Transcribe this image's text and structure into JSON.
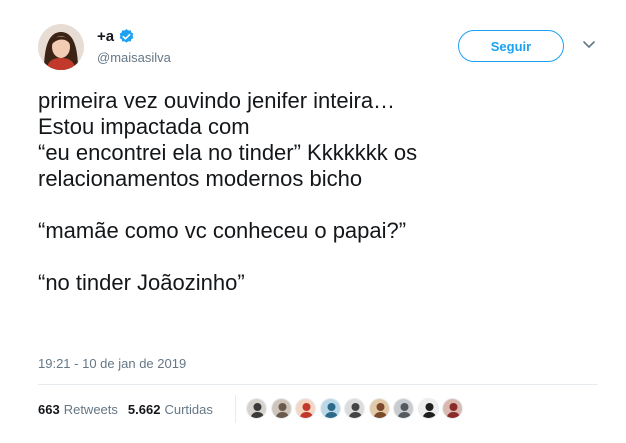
{
  "user": {
    "display_name": "+a",
    "handle": "@maisasilva",
    "avatar_icon": "user-avatar",
    "verified": true
  },
  "follow_button": {
    "label": "Seguir"
  },
  "tweet": {
    "paragraphs": [
      [
        "primeira vez ouvindo jenifer inteira…",
        "Estou impactada com",
        "“eu encontrei ela no tinder” Kkkkkkk os",
        "relacionamentos modernos bicho"
      ],
      [
        "“mamãe como vc conheceu o papai?”"
      ],
      [
        "“no tinder Joãozinho”"
      ]
    ],
    "timestamp": "19:21 - 10 de jan de 2019"
  },
  "stats": {
    "retweets_count": "663",
    "retweets_label": "Retweets",
    "likes_count": "5.662",
    "likes_label": "Curtidas"
  },
  "likers": [
    {
      "color": "#3a3a3a",
      "bg": "#d8d2cc"
    },
    {
      "color": "#6b5a4e",
      "bg": "#cfc6bb"
    },
    {
      "color": "#c0392b",
      "bg": "#f3d6c4"
    },
    {
      "color": "#2d6a8a",
      "bg": "#bcd8e6"
    },
    {
      "color": "#444444",
      "bg": "#dcdcdc"
    },
    {
      "color": "#7a4a2a",
      "bg": "#e2c9a8"
    },
    {
      "color": "#555a5e",
      "bg": "#c8ccd0"
    },
    {
      "color": "#1f1f1f",
      "bg": "#eeeeee"
    },
    {
      "color": "#8a2b2b",
      "bg": "#d9b9b0"
    }
  ],
  "colors": {
    "accent": "#1da1f2",
    "muted": "#657786",
    "text": "#14171a"
  }
}
